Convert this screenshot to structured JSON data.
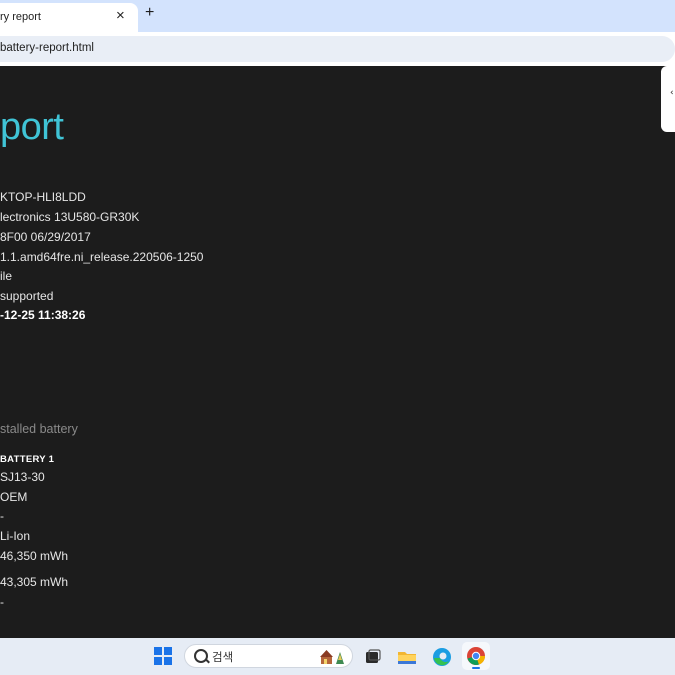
{
  "browser": {
    "tab_title": "ry report",
    "tab_close": "×",
    "new_tab": "+",
    "url": "battery-report.html"
  },
  "report": {
    "heading": "port",
    "system_info": [
      "KTOP-HLI8LDD",
      "lectronics 13U580-GR30K",
      "8F00 06/29/2017",
      "1.1.amd64fre.ni_release.220506-1250",
      "ile",
      "supported",
      "-12-25  11:38:26"
    ],
    "section_title": "stalled battery",
    "battery_label": "BATTERY 1",
    "battery_info": [
      "SJ13-30",
      "OEM",
      "-",
      "Li-Ion",
      "46,350 mWh",
      "43,305 mWh",
      "-"
    ]
  },
  "taskbar": {
    "search_placeholder": "검색"
  },
  "colors": {
    "heading_accent": "#40c4d6",
    "page_background": "#1c1c1c",
    "tab_strip": "#d3e3fd",
    "taskbar": "#e6ecf5"
  }
}
